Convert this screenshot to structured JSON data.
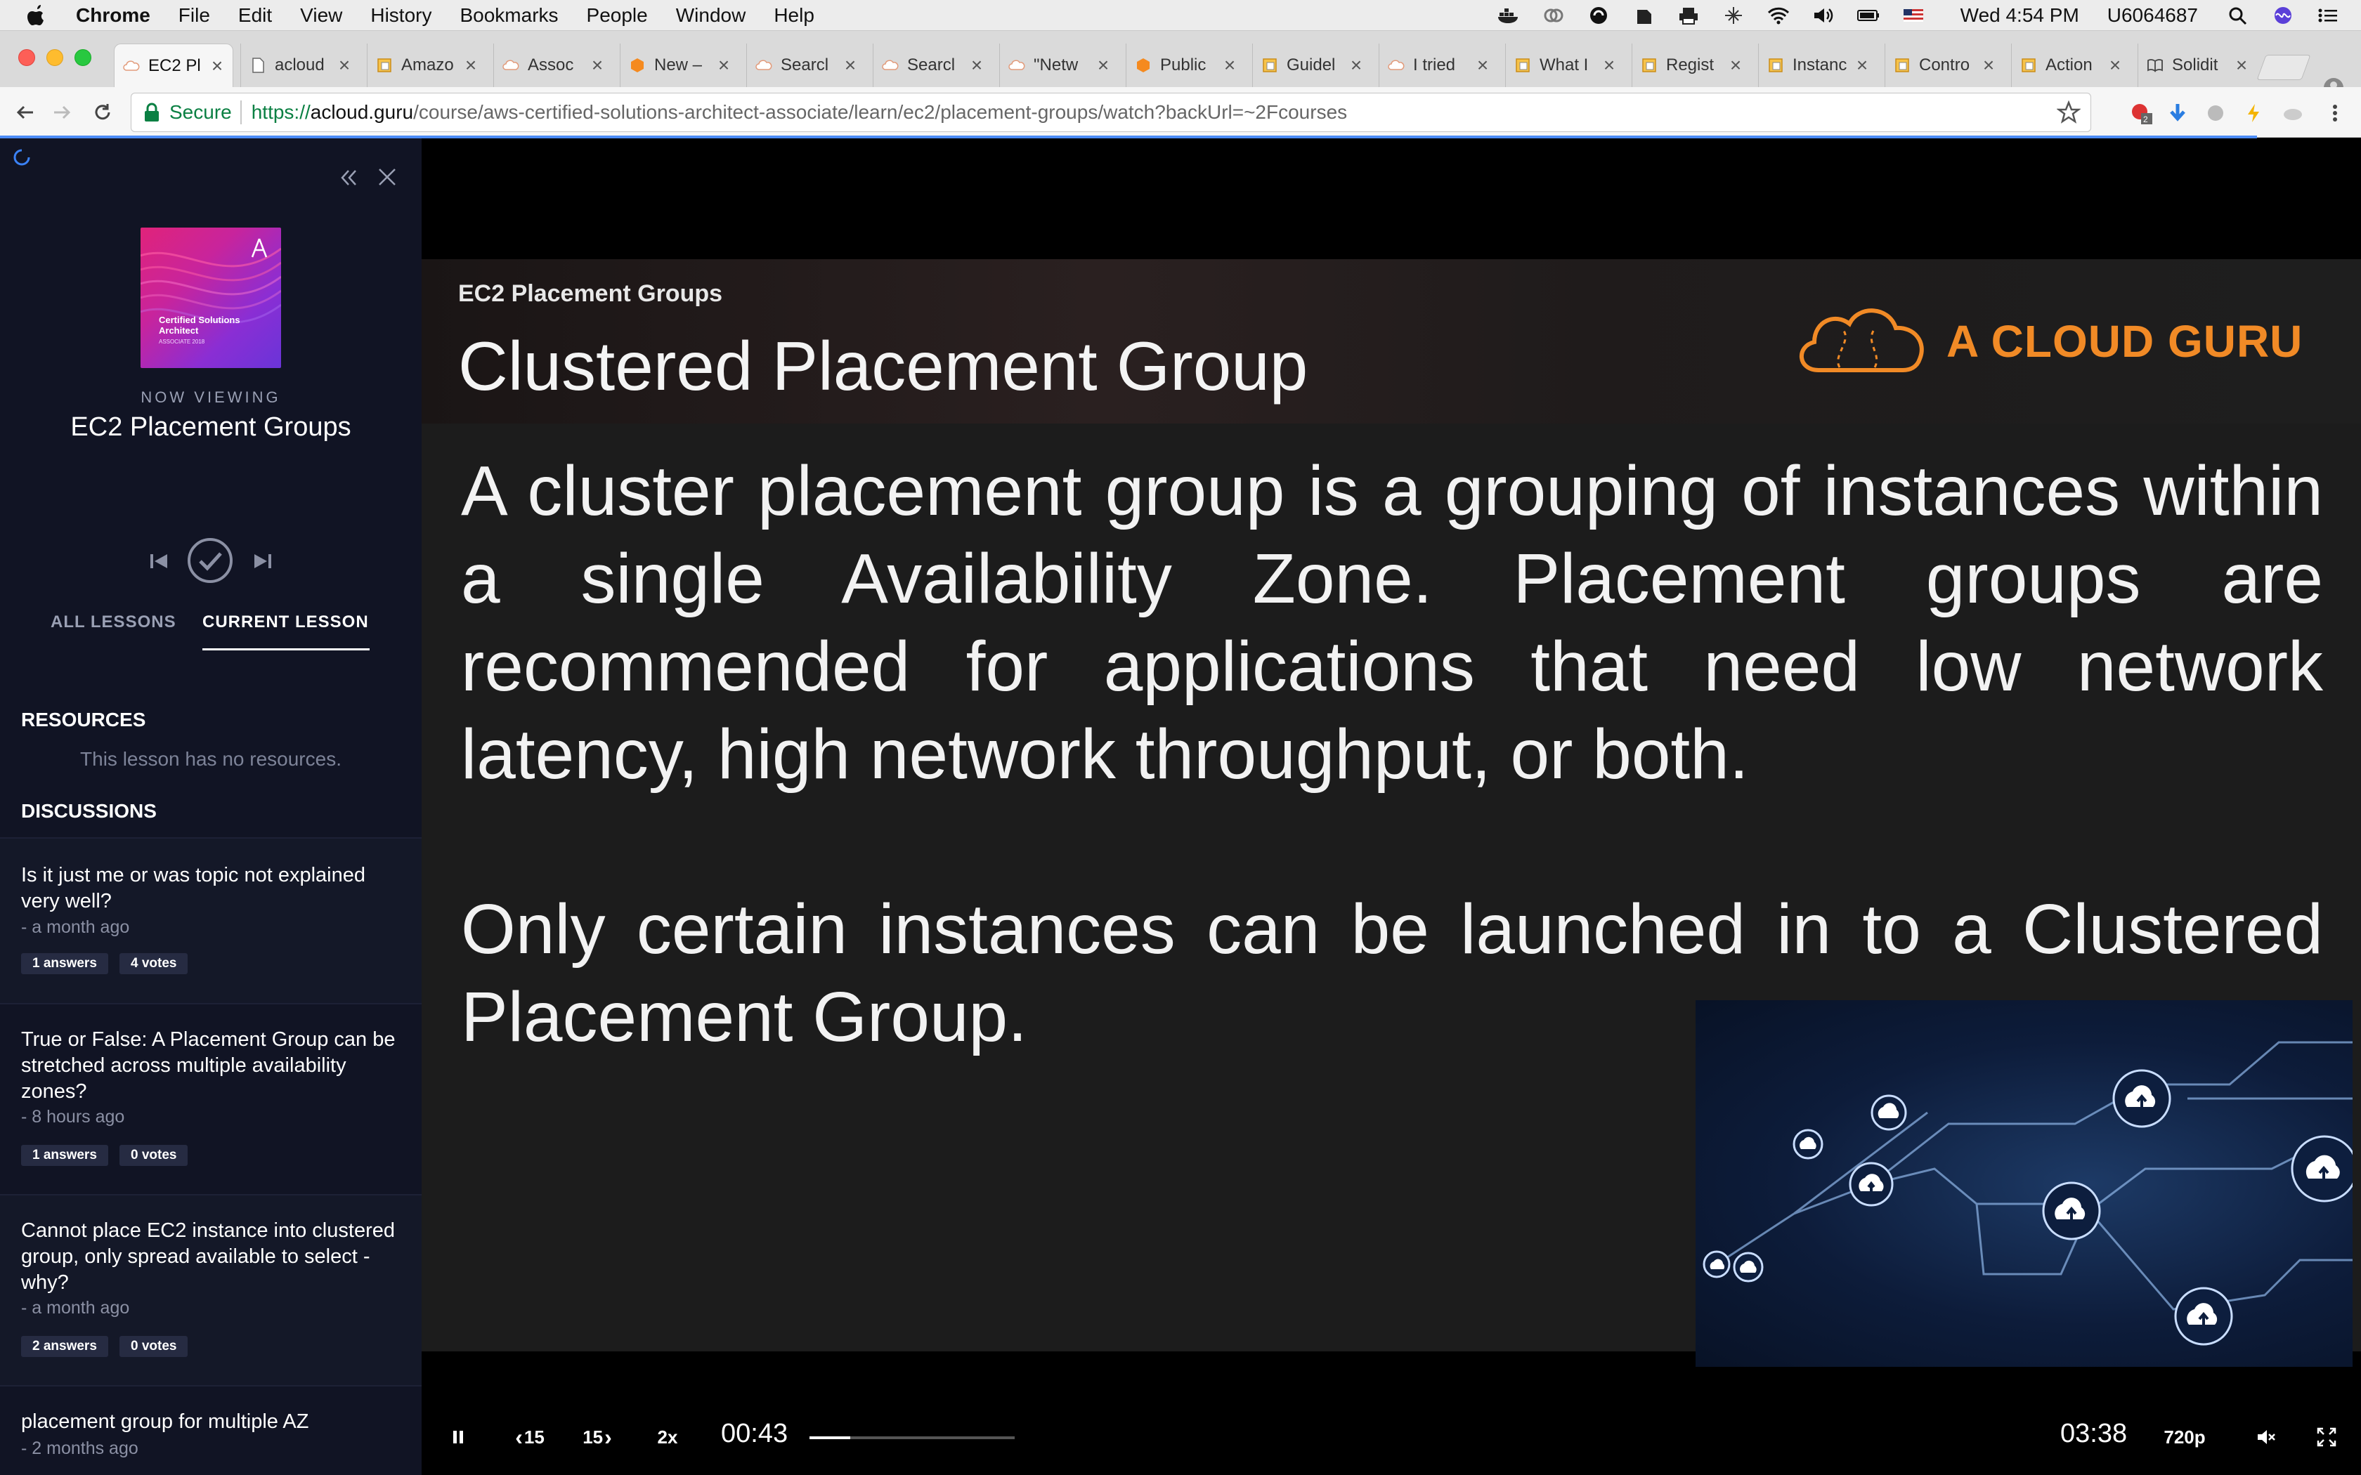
{
  "menubar": {
    "app_name": "Chrome",
    "menus": [
      "File",
      "Edit",
      "View",
      "History",
      "Bookmarks",
      "People",
      "Window",
      "Help"
    ],
    "clock": "Wed 4:54 PM",
    "user": "U6064687"
  },
  "tabs": [
    {
      "title": "EC2 Pl",
      "icon": "cloud-icon",
      "active": true
    },
    {
      "title": "acloud",
      "icon": "page-icon"
    },
    {
      "title": "Amazo",
      "icon": "aws-doc-icon"
    },
    {
      "title": "Assoc",
      "icon": "cloud-icon"
    },
    {
      "title": "New –",
      "icon": "aws-orange-icon"
    },
    {
      "title": "Searcl",
      "icon": "cloud-icon"
    },
    {
      "title": "Searcl",
      "icon": "cloud-icon"
    },
    {
      "title": "\"Netw",
      "icon": "cloud-icon"
    },
    {
      "title": "Public",
      "icon": "aws-orange-icon"
    },
    {
      "title": "Guidel",
      "icon": "aws-doc-icon"
    },
    {
      "title": "I tried",
      "icon": "cloud-icon"
    },
    {
      "title": "What I",
      "icon": "aws-doc-icon"
    },
    {
      "title": "Regist",
      "icon": "aws-doc-icon"
    },
    {
      "title": "Instanc",
      "icon": "aws-doc-icon"
    },
    {
      "title": "Contro",
      "icon": "aws-doc-icon"
    },
    {
      "title": "Action",
      "icon": "aws-doc-icon"
    },
    {
      "title": "Solidit",
      "icon": "book-icon"
    }
  ],
  "toolbar": {
    "secure_label": "Secure",
    "url_scheme": "https://",
    "url_host": "acloud.guru",
    "url_path": "/course/aws-certified-solutions-architect-associate/learn/ec2/placement-groups/watch?backUrl=~2Fcourses",
    "ext_badge": "2"
  },
  "sidebar": {
    "course_art_title": "Certified Solutions Architect",
    "course_art_sub": "ASSOCIATE 2018",
    "now_viewing": "NOW VIEWING",
    "lesson_title": "EC2 Placement Groups",
    "tab_all": "ALL LESSONS",
    "tab_current": "CURRENT LESSON",
    "resources_heading": "RESOURCES",
    "no_resources": "This lesson has no resources.",
    "discussions_heading": "DISCUSSIONS",
    "discussions": [
      {
        "title": "Is it just me or was topic not explained very well?",
        "time": "- a month ago",
        "answers": "1 answers",
        "votes": "4 votes"
      },
      {
        "title": "True or False: A Placement Group can be stretched across multiple availability zones?",
        "time": "- 8 hours ago",
        "answers": "1 answers",
        "votes": "0 votes"
      },
      {
        "title": "Cannot place EC2 instance into clustered group, only spread available to select - why?",
        "time": "- a month ago",
        "answers": "2 answers",
        "votes": "0 votes"
      },
      {
        "title": "placement group for multiple AZ",
        "time": "- 2 months ago"
      }
    ]
  },
  "slide": {
    "kicker": "EC2 Placement Groups",
    "title": "Clustered Placement Group",
    "brand": "A CLOUD GURU",
    "paragraph1": "A cluster placement group is a grouping of instances within a single Availability Zone. Placement groups are recommended for applications that need low network latency, high network throughput, or both.",
    "paragraph2": "Only certain instances can be launched in to a Clustered Placement Group."
  },
  "player": {
    "rewind_label": "15",
    "forward_label": "15",
    "speed": "2x",
    "current_time": "00:43",
    "duration": "03:38",
    "quality": "720p",
    "progress_fraction": 0.197
  },
  "colors": {
    "sidebar_bg": "#111424",
    "brand_orange": "#f18a26",
    "secure_green": "#0b8043"
  }
}
